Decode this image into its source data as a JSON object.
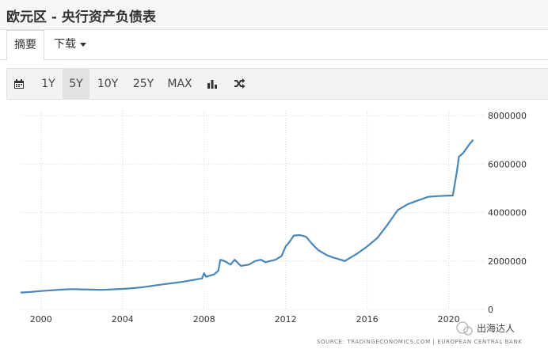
{
  "page": {
    "title": "欧元区 - 央行资产负债表"
  },
  "tabs": [
    {
      "label": "摘要"
    },
    {
      "label": "下载"
    }
  ],
  "toolbar": {
    "range_buttons": [
      "1Y",
      "5Y",
      "10Y",
      "25Y",
      "MAX"
    ],
    "active_range": "5Y",
    "icons": [
      "calendar-icon",
      "bar-chart-icon",
      "shuffle-icon"
    ]
  },
  "chart_data": {
    "type": "line",
    "title": "",
    "xlabel": "",
    "ylabel": "",
    "x_tick_labels": [
      "2000",
      "2004",
      "2008",
      "2012",
      "2016",
      "2020"
    ],
    "y_tick_labels": [
      "0",
      "2000000",
      "4000000",
      "6000000",
      "8000000"
    ],
    "xlim": [
      1999.0,
      2021.8
    ],
    "ylim": [
      0,
      8000000
    ],
    "grid": true,
    "series": [
      {
        "color": "#4a86b8",
        "points": [
          [
            1999.0,
            700000
          ],
          [
            1999.5,
            720000
          ],
          [
            2000.0,
            760000
          ],
          [
            2000.5,
            790000
          ],
          [
            2001.0,
            820000
          ],
          [
            2001.5,
            840000
          ],
          [
            2002.0,
            830000
          ],
          [
            2002.5,
            820000
          ],
          [
            2003.0,
            810000
          ],
          [
            2003.5,
            830000
          ],
          [
            2004.0,
            850000
          ],
          [
            2004.5,
            880000
          ],
          [
            2005.0,
            920000
          ],
          [
            2005.5,
            980000
          ],
          [
            2006.0,
            1040000
          ],
          [
            2006.5,
            1090000
          ],
          [
            2007.0,
            1150000
          ],
          [
            2007.5,
            1220000
          ],
          [
            2007.9,
            1280000
          ],
          [
            2008.0,
            1500000
          ],
          [
            2008.1,
            1350000
          ],
          [
            2008.5,
            1450000
          ],
          [
            2008.7,
            1600000
          ],
          [
            2008.8,
            2050000
          ],
          [
            2009.0,
            2000000
          ],
          [
            2009.3,
            1850000
          ],
          [
            2009.5,
            2050000
          ],
          [
            2009.8,
            1800000
          ],
          [
            2010.2,
            1850000
          ],
          [
            2010.5,
            2000000
          ],
          [
            2010.8,
            2050000
          ],
          [
            2011.0,
            1950000
          ],
          [
            2011.5,
            2050000
          ],
          [
            2011.8,
            2200000
          ],
          [
            2012.0,
            2600000
          ],
          [
            2012.2,
            2800000
          ],
          [
            2012.4,
            3050000
          ],
          [
            2012.7,
            3070000
          ],
          [
            2013.0,
            3000000
          ],
          [
            2013.3,
            2700000
          ],
          [
            2013.6,
            2450000
          ],
          [
            2014.0,
            2250000
          ],
          [
            2014.3,
            2150000
          ],
          [
            2014.6,
            2080000
          ],
          [
            2014.9,
            2000000
          ],
          [
            2015.2,
            2150000
          ],
          [
            2015.5,
            2300000
          ],
          [
            2016.0,
            2600000
          ],
          [
            2016.5,
            2950000
          ],
          [
            2017.0,
            3500000
          ],
          [
            2017.5,
            4100000
          ],
          [
            2018.0,
            4350000
          ],
          [
            2018.5,
            4500000
          ],
          [
            2019.0,
            4650000
          ],
          [
            2019.5,
            4680000
          ],
          [
            2020.0,
            4700000
          ],
          [
            2020.2,
            4700000
          ],
          [
            2020.3,
            5200000
          ],
          [
            2020.4,
            5700000
          ],
          [
            2020.5,
            6300000
          ],
          [
            2020.7,
            6450000
          ],
          [
            2021.0,
            6800000
          ],
          [
            2021.2,
            7000000
          ]
        ]
      }
    ],
    "source": "SOURCE: TRADINGECONOMICS.COM | EUROPEAN CENTRAL BANK"
  },
  "watermark": {
    "text": "出海达人"
  }
}
